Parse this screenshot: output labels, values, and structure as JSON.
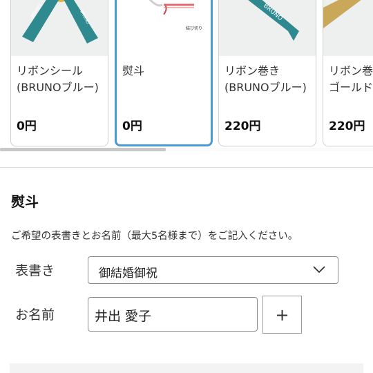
{
  "carousel": {
    "items": [
      {
        "name": "リボンシール(BRUNOブルー)",
        "price": "0円",
        "selected": false
      },
      {
        "name": "熨斗",
        "price": "0円",
        "selected": true,
        "noshi_tag": "結び切り"
      },
      {
        "name": "リボン巻き(BRUNOブルー)",
        "price": "220円",
        "selected": false,
        "ribbon_text": "BRUNO"
      },
      {
        "name": "リボン巻きゴールド無",
        "price": "220円",
        "selected": false
      }
    ],
    "ribbon_label": "BRUNO"
  },
  "noshi": {
    "title": "熨斗",
    "description": "ご希望の表書きとお名前（最大5名様まで）をご記入ください。",
    "omote_label": "表書き",
    "omote_value": "御結婚御祝",
    "name_label": "お名前",
    "name_value": "井出 愛子",
    "add_label": "+"
  },
  "colors": {
    "accent": "#4a9ad4",
    "ribbon": "#2e8a8e",
    "gold": "#d8b34a"
  }
}
